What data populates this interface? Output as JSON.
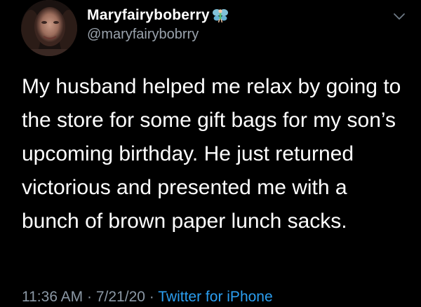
{
  "user": {
    "display_name": "Maryfairyboberry",
    "handle": "@maryfairybobrry",
    "avatar_icon": "profile-photo",
    "badge_icon": "fairy-emoji"
  },
  "tweet": {
    "text": "My husband helped me relax by going to the store for some gift bags for my son’s upcoming birthday. He just returned victorious and presented me with a bunch of brown paper lunch sacks.",
    "time": "11:36 AM",
    "separator": "·",
    "date": "7/21/20",
    "source": "Twitter for iPhone"
  },
  "colors": {
    "background": "#000000",
    "text": "#ffffff",
    "secondary": "#8b98a5",
    "link": "#2b9ef0"
  }
}
